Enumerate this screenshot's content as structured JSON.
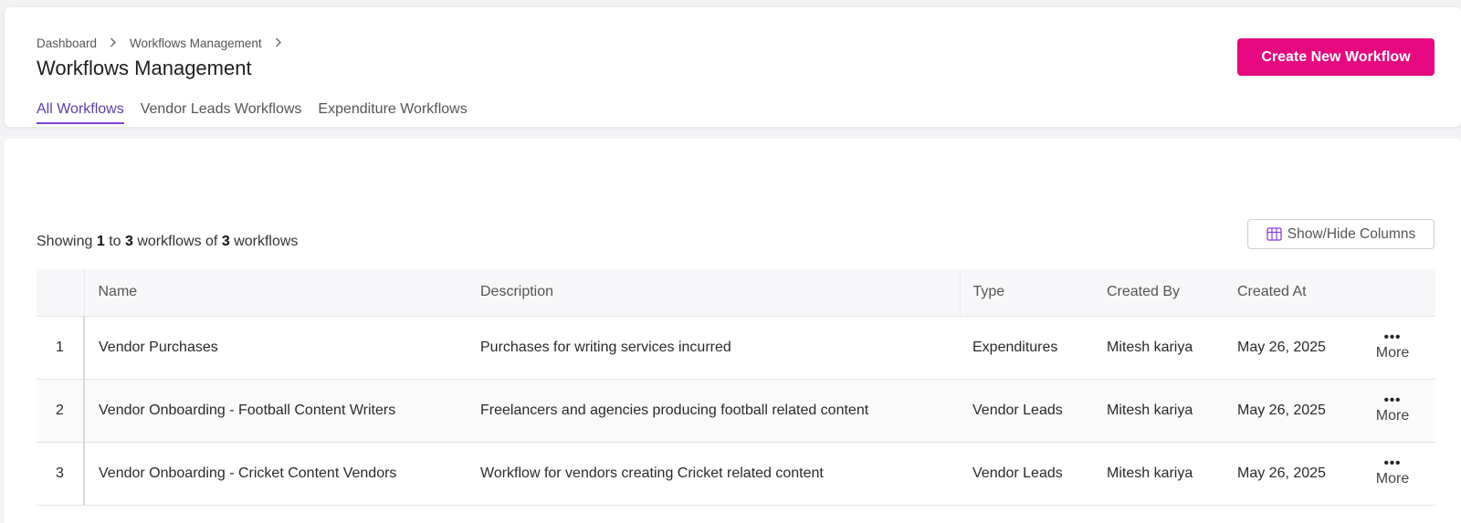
{
  "breadcrumb": {
    "items": [
      "Dashboard",
      "Workflows Management"
    ]
  },
  "page_title": "Workflows Management",
  "create_button_label": "Create New Workflow",
  "tabs": [
    {
      "label": "All Workflows",
      "active": true
    },
    {
      "label": "Vendor Leads Workflows",
      "active": false
    },
    {
      "label": "Expenditure Workflows",
      "active": false
    }
  ],
  "showing": {
    "prefix": "Showing",
    "from": "1",
    "to_word": "to",
    "to": "3",
    "mid": "workflows of",
    "total": "3",
    "suffix": "workflows"
  },
  "columns_button_label": "Show/Hide Columns",
  "table": {
    "headers": {
      "idx": "",
      "name": "Name",
      "description": "Description",
      "type": "Type",
      "created_by": "Created By",
      "created_at": "Created At"
    },
    "more_label": "More",
    "rows": [
      {
        "idx": "1",
        "name": "Vendor Purchases",
        "description": "Purchases for writing services incurred",
        "type": "Expenditures",
        "created_by": "Mitesh kariya",
        "created_at": "May 26, 2025"
      },
      {
        "idx": "2",
        "name": "Vendor Onboarding - Football Content Writers",
        "description": "Freelancers and agencies producing football related content",
        "type": "Vendor Leads",
        "created_by": "Mitesh kariya",
        "created_at": "May 26, 2025"
      },
      {
        "idx": "3",
        "name": "Vendor Onboarding - Cricket Content Vendors",
        "description": "Workflow for vendors creating Cricket related content",
        "type": "Vendor Leads",
        "created_by": "Mitesh kariya",
        "created_at": "May 26, 2025"
      }
    ]
  },
  "colors": {
    "accent": "#e5087e",
    "tab_active": "#7b3fc9"
  },
  "icons": {
    "breadcrumb_separator": "chevron-right-icon",
    "columns": "table-columns-icon",
    "row_menu": "more-horizontal-icon"
  }
}
